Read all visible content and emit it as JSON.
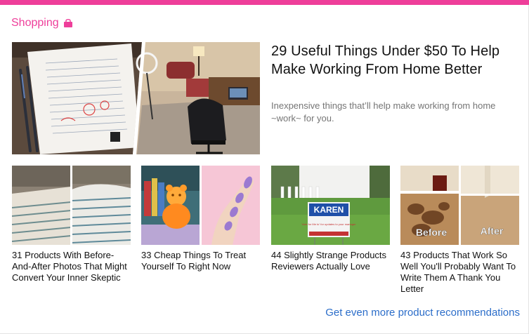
{
  "section": {
    "title": "Shopping"
  },
  "hero": {
    "title": "29 Useful Things Under $50 To Help Make Working From Home Better",
    "description": "Inexpensive things that’ll help make working from home ~work~ for you."
  },
  "cards": [
    {
      "title": "31 Products With Before-And-After Photos That Might Convert Your Inner Skeptic"
    },
    {
      "title": "33 Cheap Things To Treat Yourself To Right Now"
    },
    {
      "title": "44 Slightly Strange Products Reviewers Actually Love",
      "sign_text": "KAREN",
      "sign_subtext": "Vote for Me to’ for updates to your manager"
    },
    {
      "title": "43 Products That Work So Well You'll Probably Want To Write Them A Thank You Letter",
      "before_label": "Before",
      "after_label": "After"
    }
  ],
  "footer": {
    "more_link": "Get even more product recommendations"
  },
  "colors": {
    "accent": "#ee3e9a",
    "link": "#2b6dc9"
  },
  "icons": {
    "section_icon": "shopping-bag-icon"
  }
}
